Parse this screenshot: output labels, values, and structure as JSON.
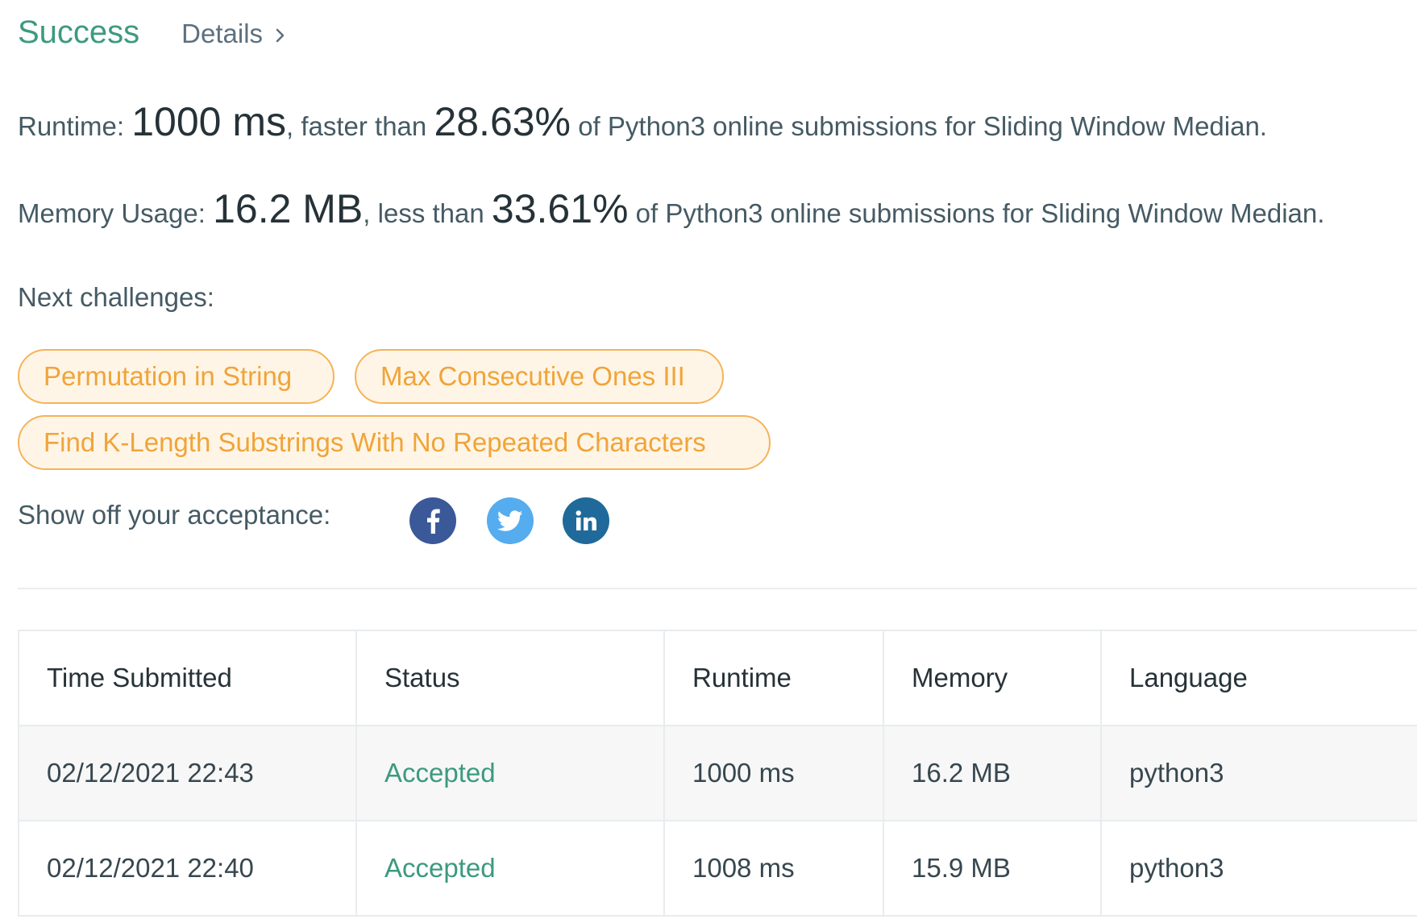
{
  "header": {
    "status": "Success",
    "details_label": "Details"
  },
  "runtime_line": {
    "label": "Runtime: ",
    "value": "1000 ms",
    "middle": ", faster than ",
    "percent": "28.63%",
    "suffix": " of Python3 online submissions for Sliding Window Median."
  },
  "memory_line": {
    "label": "Memory Usage: ",
    "value": "16.2 MB",
    "middle": ", less than ",
    "percent": "33.61%",
    "suffix": " of Python3 online submissions for Sliding Window Median."
  },
  "next": {
    "title": "Next challenges:",
    "challenges": [
      "Permutation in String",
      "Max Consecutive Ones III",
      "Find K-Length Substrings With No Repeated Characters"
    ]
  },
  "share": {
    "label": "Show off your acceptance:",
    "icons": [
      "facebook-icon",
      "twitter-icon",
      "linkedin-icon"
    ]
  },
  "colors": {
    "success": "#3c9a7f",
    "chip_border": "#f5b35a",
    "chip_text": "#f0a43a",
    "facebook": "#3b5998",
    "twitter": "#55acee",
    "linkedin": "#1f6a9a"
  },
  "table": {
    "headers": [
      "Time Submitted",
      "Status",
      "Runtime",
      "Memory",
      "Language"
    ],
    "rows": [
      [
        "02/12/2021 22:43",
        "Accepted",
        "1000 ms",
        "16.2 MB",
        "python3"
      ],
      [
        "02/12/2021 22:40",
        "Accepted",
        "1008 ms",
        "15.9 MB",
        "python3"
      ]
    ]
  }
}
